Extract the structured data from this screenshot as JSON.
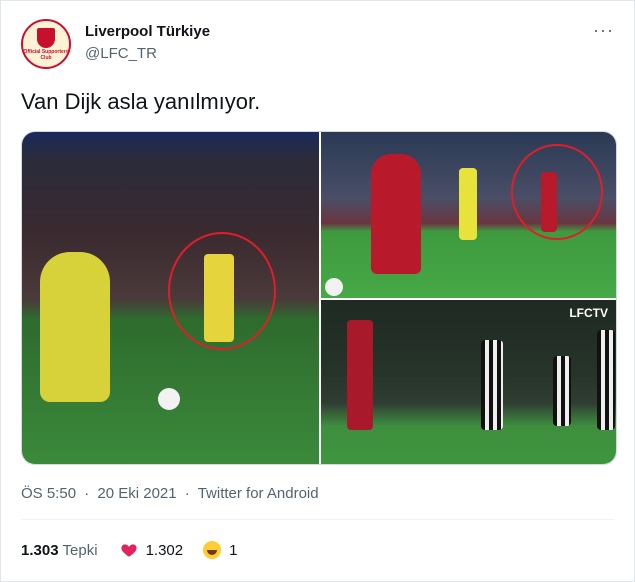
{
  "user": {
    "display_name": "Liverpool Türkiye",
    "handle": "@LFC_TR",
    "avatar_text": "Official Supporters Club"
  },
  "tweet": {
    "text": "Van Dijk asla yanılmıyor."
  },
  "media": {
    "watermark": "LFCTV"
  },
  "meta": {
    "time": "ÖS 5:50",
    "sep1": "·",
    "date": "20 Eki 2021",
    "sep2": "·",
    "source": "Twitter for Android"
  },
  "stats": {
    "reactions_count": "1.303",
    "reactions_label": "Tepki",
    "likes_count": "1.302",
    "laugh_count": "1"
  },
  "icons": {
    "more": "more-dots-icon",
    "heart": "heart-icon",
    "laugh": "laughing-emoji-icon"
  },
  "colors": {
    "heart": "#e0245e",
    "text_secondary": "#536471",
    "highlight_circle": "#e01e2a"
  }
}
